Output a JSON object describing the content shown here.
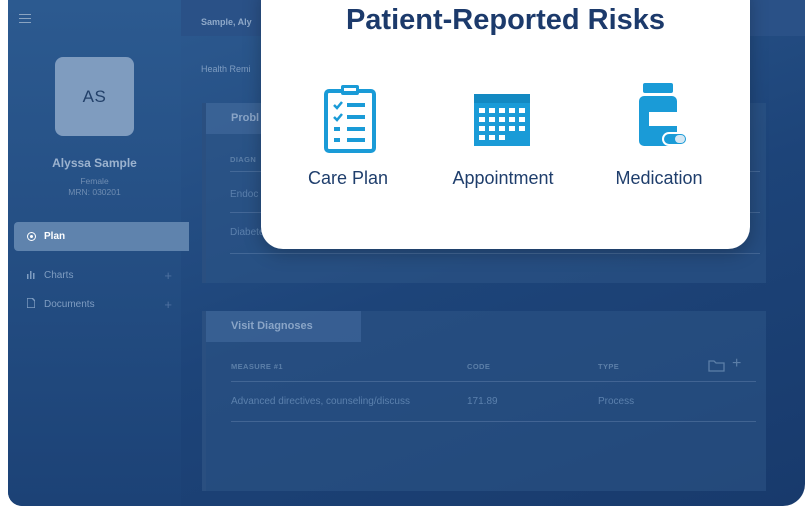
{
  "sidebar": {
    "avatar_initials": "AS",
    "patient_name": "Alyssa Sample",
    "patient_gender": "Female",
    "patient_mrn": "MRN: 030201",
    "nav": {
      "plan": "Plan",
      "charts": "Charts",
      "documents": "Documents"
    }
  },
  "header": {
    "breadcrumb": "Sample, Aly",
    "sub_section": "Health Remi"
  },
  "problems_panel": {
    "tab": "Probl",
    "column_header": "DIAGN",
    "rows": [
      "Endoc",
      "Diabete"
    ]
  },
  "visit_panel": {
    "tab": "Visit Diagnoses",
    "columns": [
      "MEASURE #1",
      "CODE",
      "TYPE"
    ],
    "rows": [
      {
        "measure": "Advanced directives, counseling/discuss",
        "code": "171.89",
        "type": "Process"
      }
    ]
  },
  "modal": {
    "title": "Patient-Reported Risks",
    "options": [
      {
        "label": "Care Plan",
        "icon": "clipboard-checklist-icon"
      },
      {
        "label": "Appointment",
        "icon": "calendar-icon"
      },
      {
        "label": "Medication",
        "icon": "pill-bottle-icon"
      }
    ]
  },
  "colors": {
    "accent": "#1a9bd7",
    "modal_title": "#1c3a6b",
    "background": "#1d4479"
  }
}
